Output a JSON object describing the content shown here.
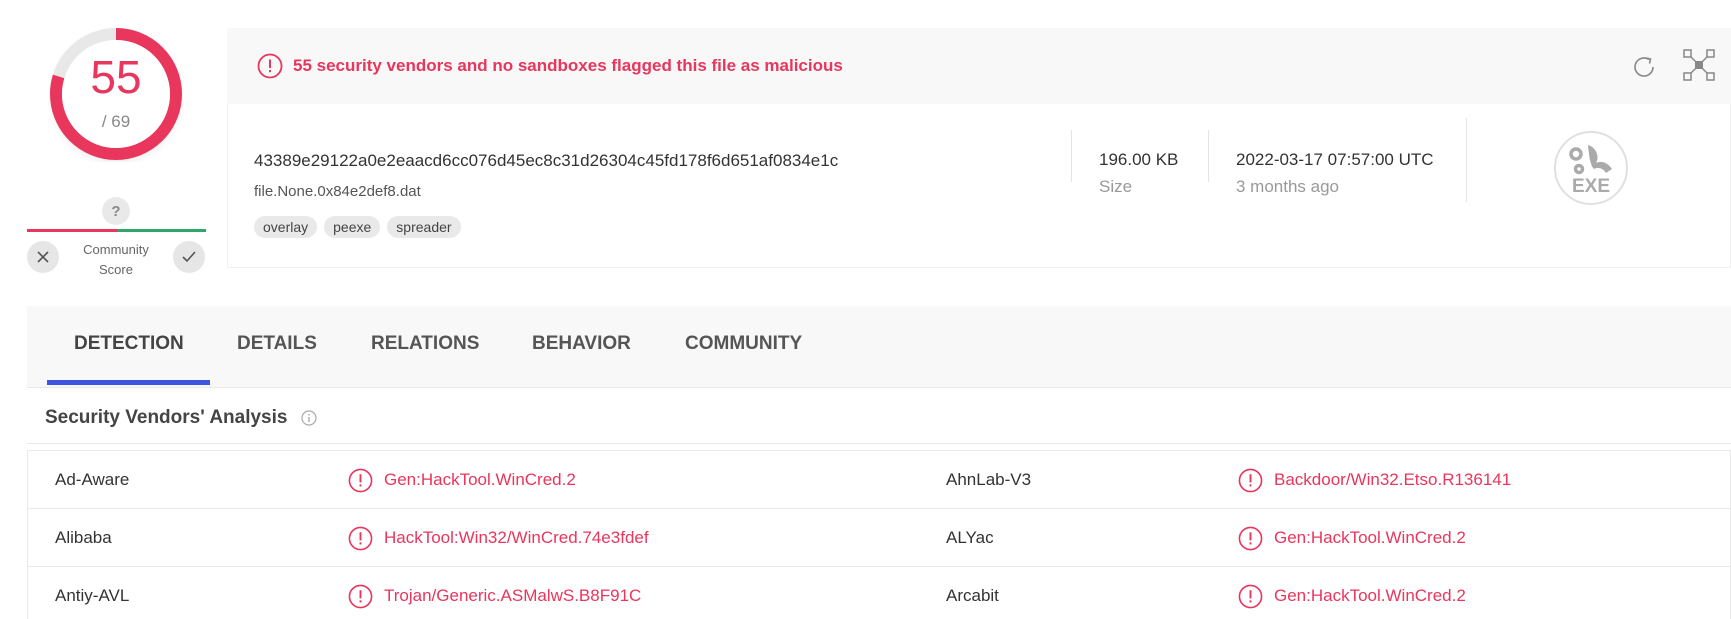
{
  "score": {
    "detections": "55",
    "total": "/ 69",
    "fraction": 0.797
  },
  "community": {
    "unknown_symbol": "?",
    "label": "Community Score",
    "vote_down_icon": "x-icon",
    "vote_up_icon": "check-icon"
  },
  "banner": {
    "message": "55 security vendors and no sandboxes flagged this file as malicious",
    "reload_icon": "reload-icon",
    "graph_icon": "graph-icon"
  },
  "file": {
    "hash": "43389e29122a0e2eaacd6cc076d45ec8c31d26304c45fd178f6d651af0834e1c",
    "name": "file.None.0x84e2def8.dat",
    "tags": [
      "overlay",
      "peexe",
      "spreader"
    ],
    "size_value": "196.00 KB",
    "size_label": "Size",
    "date_value": "2022-03-17 07:57:00 UTC",
    "date_label": "3 months ago",
    "type_icon_text": "EXE"
  },
  "tabs": [
    {
      "label": "DETECTION",
      "active": true
    },
    {
      "label": "DETAILS",
      "active": false
    },
    {
      "label": "RELATIONS",
      "active": false
    },
    {
      "label": "BEHAVIOR",
      "active": false
    },
    {
      "label": "COMMUNITY",
      "active": false
    }
  ],
  "section": {
    "title": "Security Vendors' Analysis"
  },
  "vendors": [
    {
      "left_name": "Ad-Aware",
      "left_result": "Gen:HackTool.WinCred.2",
      "right_name": "AhnLab-V3",
      "right_result": "Backdoor/Win32.Etso.R136141"
    },
    {
      "left_name": "Alibaba",
      "left_result": "HackTool:Win32/WinCred.74e3fdef",
      "right_name": "ALYac",
      "right_result": "Gen:HackTool.WinCred.2"
    },
    {
      "left_name": "Antiy-AVL",
      "left_result": "Trojan/Generic.ASMalwS.B8F91C",
      "right_name": "Arcabit",
      "right_result": "Gen:HackTool.WinCred.2"
    }
  ],
  "colors": {
    "malicious": "#e8365d",
    "accent": "#3d55e1",
    "positive": "#2ea86a"
  }
}
